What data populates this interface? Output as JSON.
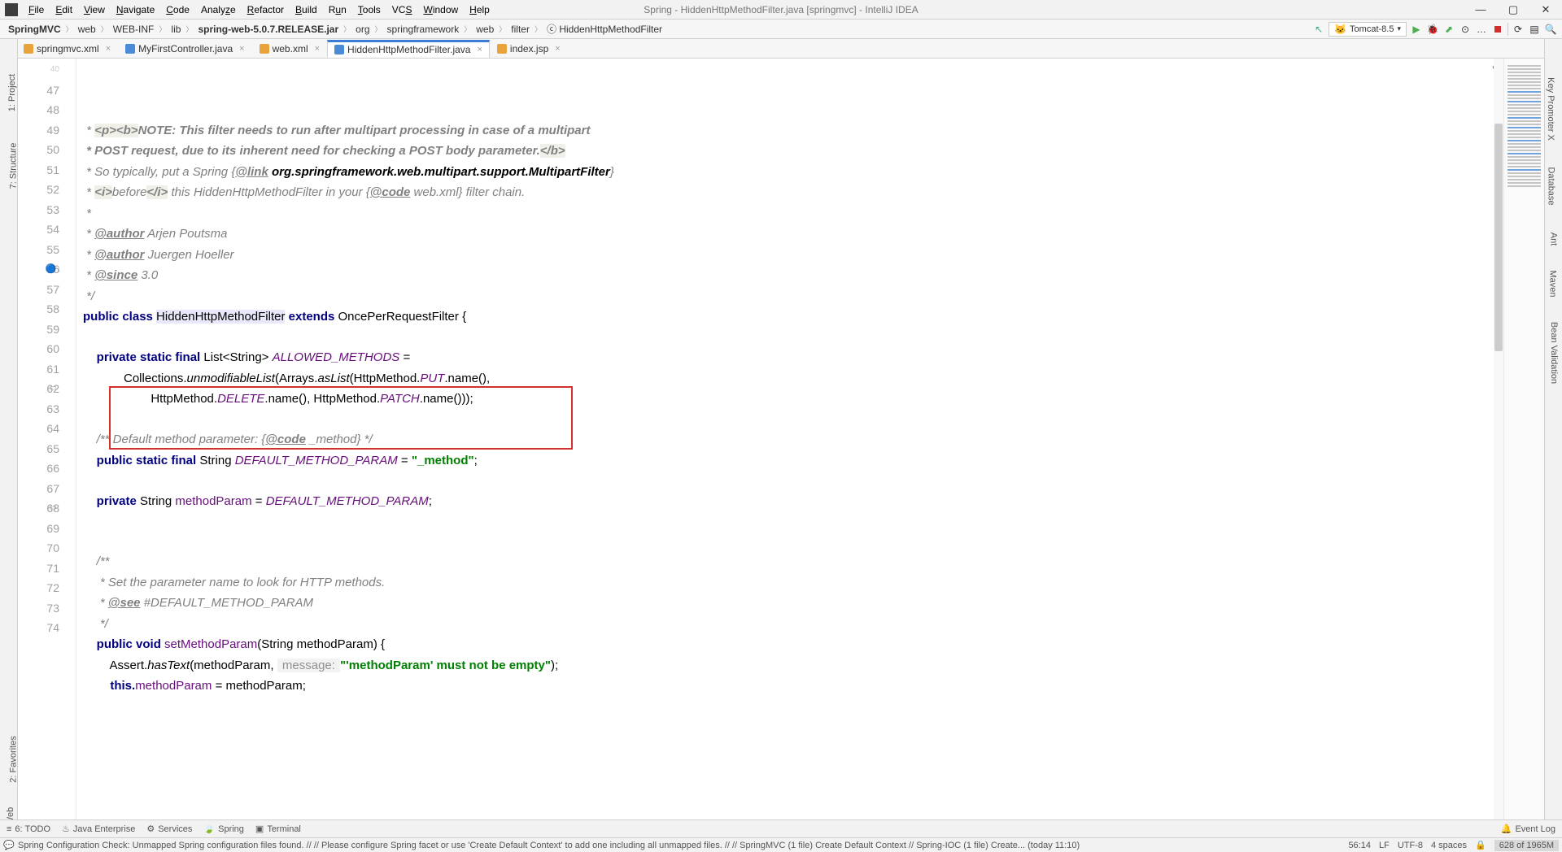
{
  "window": {
    "title": "Spring - HiddenHttpMethodFilter.java [springmvc] - IntelliJ IDEA"
  },
  "menu": [
    "File",
    "Edit",
    "View",
    "Navigate",
    "Code",
    "Analyze",
    "Refactor",
    "Build",
    "Run",
    "Tools",
    "VCS",
    "Window",
    "Help"
  ],
  "breadcrumbs": [
    "SpringMVC",
    "web",
    "WEB-INF",
    "lib",
    "spring-web-5.0.7.RELEASE.jar",
    "org",
    "springframework",
    "web",
    "filter",
    "HiddenHttpMethodFilter"
  ],
  "run_config": "Tomcat-8.5",
  "tabs": [
    {
      "name": "springmvc.xml",
      "active": false,
      "ico": "xml"
    },
    {
      "name": "MyFirstController.java",
      "active": false,
      "ico": "java"
    },
    {
      "name": "web.xml",
      "active": false,
      "ico": "xml"
    },
    {
      "name": "HiddenHttpMethodFilter.java",
      "active": true,
      "ico": "java"
    },
    {
      "name": "index.jsp",
      "active": false,
      "ico": "xml"
    }
  ],
  "left_tools": {
    "l1": "1: Project",
    "l2": "7: Structure",
    "l3": "2: Favorites",
    "l4": "Web"
  },
  "right_tools": {
    "r1": "Key Promoter X",
    "r2": "Database",
    "r3": "Ant",
    "r4": "Maven",
    "r5": "Bean Validation"
  },
  "gutter_start": 47,
  "bottom_tools": {
    "todo": "6: TODO",
    "ent": "Java Enterprise",
    "svc": "Services",
    "spring": "Spring",
    "term": "Terminal",
    "eventlog": "Event Log"
  },
  "status": {
    "msg": "Spring Configuration Check: Unmapped Spring configuration files found. // // Please configure Spring facet or use 'Create Default Context' to add one including all unmapped files. // // SpringMVC (1 file)   Create Default Context // Spring-IOC (1 file)   Create... (today 11:10)",
    "pos": "56:14",
    "enc": "LF",
    "cs": "UTF-8",
    "indent": "4 spaces",
    "mem": "628 of 1965M"
  },
  "code": {
    "l47a": " * ",
    "l47b": "<p><b>",
    "l47c": "NOTE: This filter needs to run after multipart processing in case of a multipart",
    "l48a": " * POST request, due to its inherent need for checking a POST body parameter.",
    "l48b": "</b>",
    "l49a": " * So typically, put a Spring {",
    "l49b": "@link",
    "l49c": " org.springframework.web.multipart.support.MultipartFilter",
    "l49d": "}",
    "l50a": " * ",
    "l50b": "<i>",
    "l50c": "before",
    "l50d": "</i>",
    "l50e": " this HiddenHttpMethodFilter in your {",
    "l50f": "@code",
    "l50g": " web.xml} filter chain.",
    "l51": " *",
    "l52a": " * ",
    "l52b": "@author",
    "l52c": " Arjen Poutsma",
    "l53a": " * ",
    "l53b": "@author",
    "l53c": " Juergen Hoeller",
    "l54a": " * ",
    "l54b": "@since",
    "l54c": " 3.0",
    "l55": " */",
    "l56a": "public",
    "l56b": " class ",
    "l56c": "HiddenHttpMethodFilter",
    "l56d": " extends ",
    "l56e": "OncePerRequestFilter {",
    "l58a": "    private static final ",
    "l58b": "List<String> ",
    "l58c": "ALLOWED_METHODS",
    "l58d": " =",
    "l59a": "            Collections.",
    "l59b": "unmodifiableList",
    "l59c": "(Arrays.",
    "l59d": "asList",
    "l59e": "(HttpMethod.",
    "l59f": "PUT",
    "l59g": ".name(),",
    "l60a": "                    HttpMethod.",
    "l60b": "DELETE",
    "l60c": ".name(), HttpMethod.",
    "l60d": "PATCH",
    "l60e": ".name()));",
    "l62a": "    /** Default method parameter: {",
    "l62b": "@code",
    "l62c": " _method} */",
    "l63a": "    public static final ",
    "l63b": "String ",
    "l63c": "DEFAULT_METHOD_PARAM",
    "l63d": " = ",
    "l63e": "\"_method\"",
    "l63f": ";",
    "l65a": "    private ",
    "l65b": "String ",
    "l65c": "methodParam",
    "l65d": " = ",
    "l65e": "DEFAULT_METHOD_PARAM",
    "l65f": ";",
    "l68": "    /**",
    "l69": "     * Set the parameter name to look for HTTP methods.",
    "l70a": "     * ",
    "l70b": "@see",
    "l70c": " #DEFAULT_METHOD_PARAM",
    "l71": "     */",
    "l72a": "    public ",
    "l72b": "void ",
    "l72c": "setMethodParam",
    "l72d": "(String methodParam) {",
    "l73a": "        Assert.",
    "l73b": "hasText",
    "l73c": "(methodParam, ",
    "l73h": " message: ",
    "l73d": "\"'methodParam' must not be empty\"",
    "l73e": ");",
    "l74a": "        this.",
    "l74b": "methodParam",
    "l74c": " = methodParam;"
  }
}
